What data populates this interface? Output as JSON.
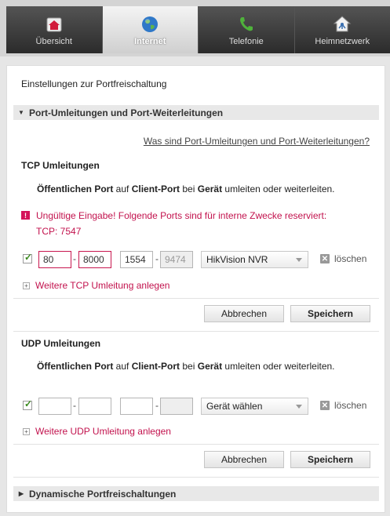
{
  "nav": {
    "tabs": [
      {
        "label": "Übersicht",
        "icon": "home-icon",
        "active": false
      },
      {
        "label": "Internet",
        "icon": "globe-icon",
        "active": true
      },
      {
        "label": "Telefonie",
        "icon": "phone-icon",
        "active": false
      },
      {
        "label": "Heimnetzwerk",
        "icon": "home-network-icon",
        "active": false
      }
    ]
  },
  "page": {
    "title": "Einstellungen zur Portfreischaltung"
  },
  "section_port": {
    "label": "Port-Umleitungen und Port-Weiterleitungen",
    "help_link": "Was sind Port-Umleitungen und Port-Weiterleitungen?"
  },
  "tcp": {
    "title": "TCP Umleitungen",
    "desc": {
      "p1": "Öffentlichen Port",
      "p2": " auf ",
      "p3": "Client-Port",
      "p4": " bei ",
      "p5": "Gerät",
      "p6": " umleiten oder weiterleiten."
    },
    "warning_line1": "Ungültige Eingabe! Folgende Ports sind für interne Zwecke reserviert:",
    "warning_line2": "TCP: 7547",
    "row": {
      "checked": true,
      "public_from": "80",
      "public_to": "8000",
      "client_from": "1554",
      "client_to": "9474",
      "device": "HikVision NVR",
      "delete_label": "löschen"
    },
    "add_label": "Weitere TCP Umleitung anlegen",
    "cancel": "Abbrechen",
    "save": "Speichern"
  },
  "udp": {
    "title": "UDP Umleitungen",
    "desc": {
      "p1": "Öffentlichen Port",
      "p2": " auf ",
      "p3": "Client-Port",
      "p4": " bei ",
      "p5": "Gerät",
      "p6": " umleiten oder weiterleiten."
    },
    "row": {
      "checked": true,
      "public_from": "",
      "public_to": "",
      "client_from": "",
      "client_to": "",
      "device": "Gerät wählen",
      "delete_label": "löschen"
    },
    "add_label": "Weitere UDP Umleitung anlegen",
    "cancel": "Abbrechen",
    "save": "Speichern"
  },
  "section_dynamic": {
    "label": "Dynamische Portfreischaltungen"
  },
  "colors": {
    "accent": "#c2124d",
    "nav_dark": "#3a3a3a",
    "check": "#3a8a1e"
  }
}
